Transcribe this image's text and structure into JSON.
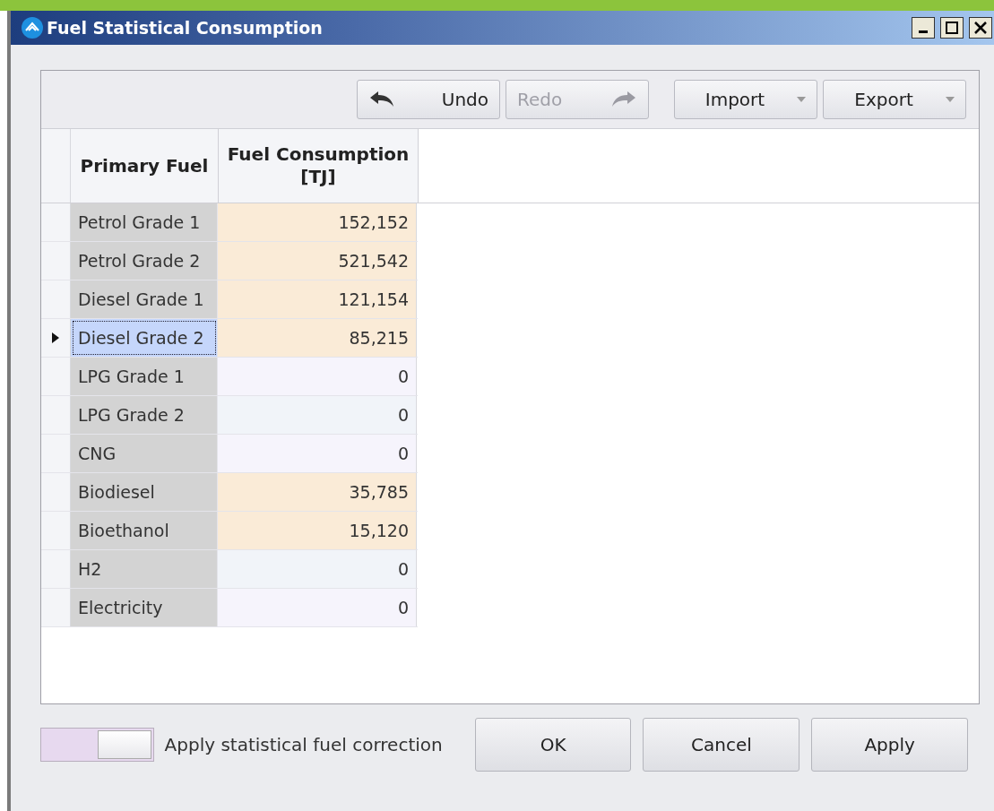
{
  "window": {
    "title": "Fuel Statistical Consumption"
  },
  "toolbar": {
    "buttons": [
      {
        "kind": "undo",
        "label": "Undo",
        "disabled": false
      },
      {
        "kind": "redo",
        "label": "Redo",
        "disabled": true
      },
      {
        "kind": "dropdown",
        "label": "Import",
        "disabled": false
      },
      {
        "kind": "dropdown",
        "label": "Export",
        "disabled": false
      }
    ]
  },
  "table": {
    "columns": [
      "Primary Fuel",
      "Fuel Consumption\n[TJ]"
    ],
    "rows": [
      {
        "fuel": "Petrol Grade 1",
        "consumption": "152,152",
        "color": "#faebd7",
        "selected": false
      },
      {
        "fuel": "Petrol Grade 2",
        "consumption": "521,542",
        "color": "#faebd7",
        "selected": false
      },
      {
        "fuel": "Diesel Grade 1",
        "consumption": "121,154",
        "color": "#faebd7",
        "selected": false
      },
      {
        "fuel": "Diesel Grade 2",
        "consumption": "85,215",
        "color": "#faebd7",
        "selected": true
      },
      {
        "fuel": "LPG Grade 1",
        "consumption": "0",
        "color": "#f6f4fc",
        "selected": false
      },
      {
        "fuel": "LPG Grade 2",
        "consumption": "0",
        "color": "#f1f4f9",
        "selected": false
      },
      {
        "fuel": "CNG",
        "consumption": "0",
        "color": "#f6f4fc",
        "selected": false
      },
      {
        "fuel": "Biodiesel",
        "consumption": "35,785",
        "color": "#faebd7",
        "selected": false
      },
      {
        "fuel": "Bioethanol",
        "consumption": "15,120",
        "color": "#faebd7",
        "selected": false
      },
      {
        "fuel": "H2",
        "consumption": "0",
        "color": "#f1f4f9",
        "selected": false
      },
      {
        "fuel": "Electricity",
        "consumption": "0",
        "color": "#f6f4fc",
        "selected": false
      }
    ]
  },
  "correction_toggle": {
    "label": "Apply statistical fuel correction",
    "on": true
  },
  "buttons": [
    "OK",
    "Cancel",
    "Apply"
  ]
}
